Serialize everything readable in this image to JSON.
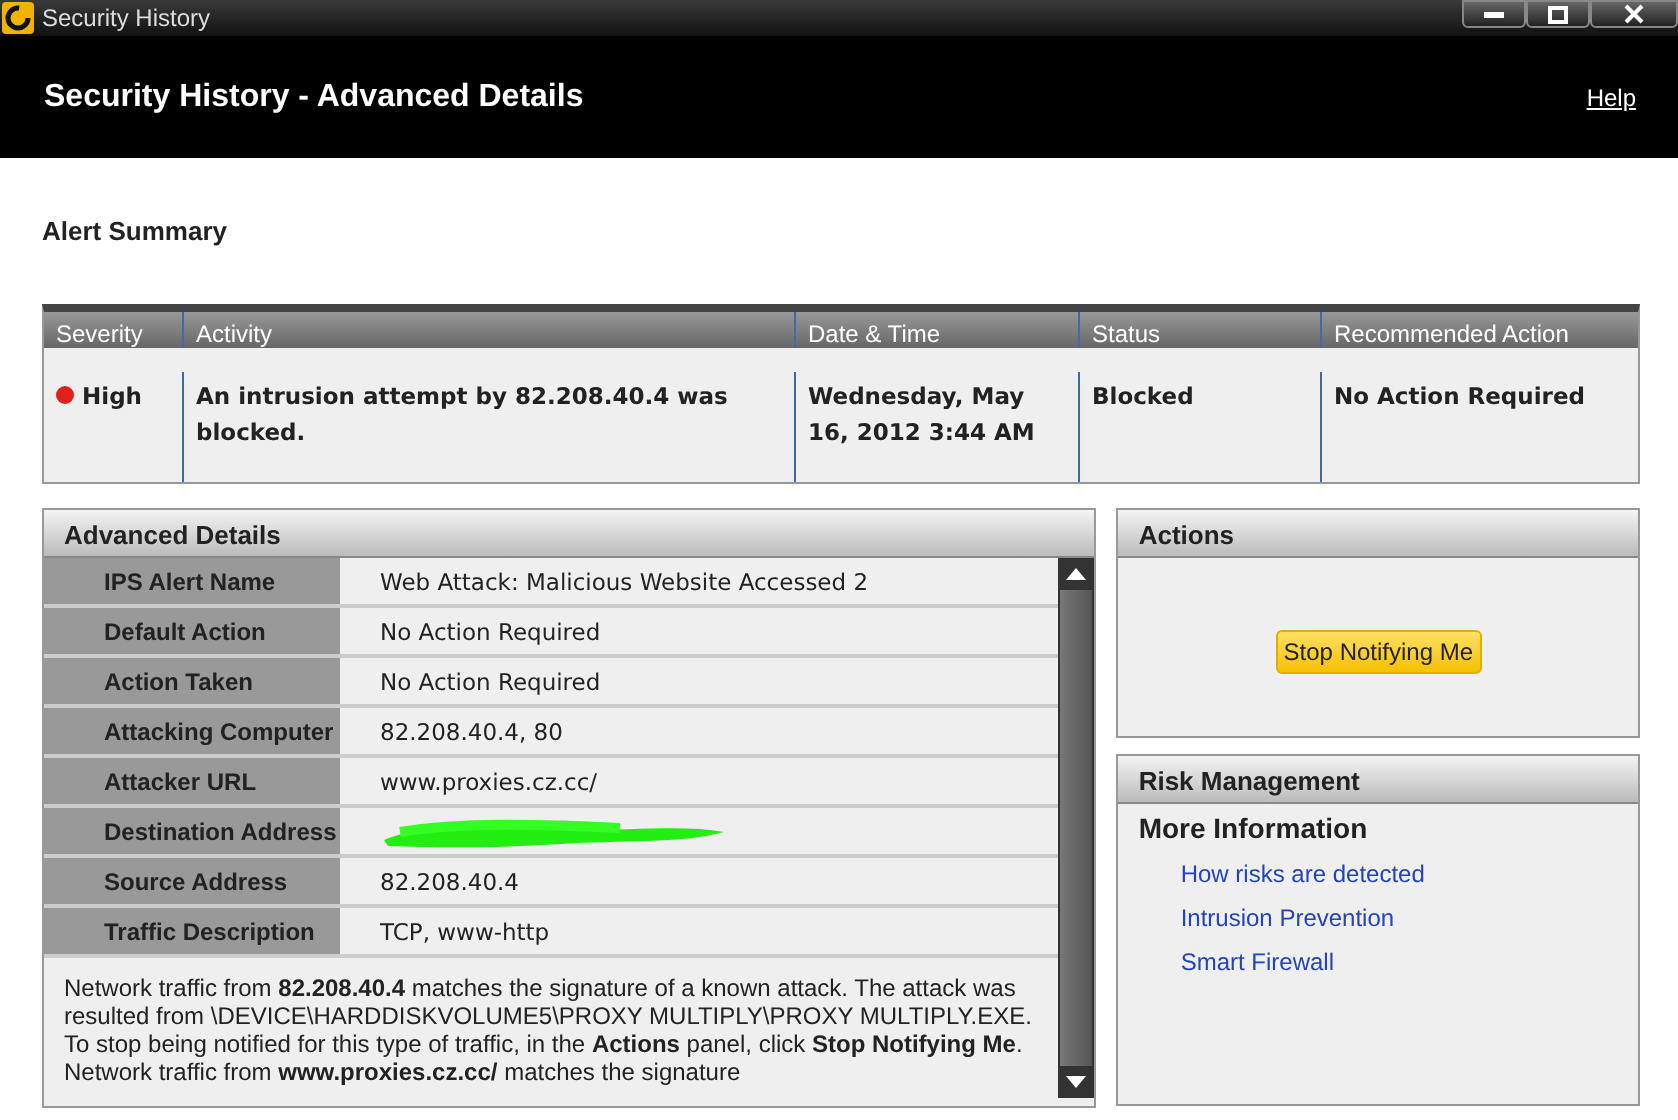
{
  "window": {
    "title": "Security History"
  },
  "header": {
    "title": "Security History - Advanced Details",
    "help_link": "Help"
  },
  "alert_summary": {
    "title": "Alert Summary",
    "columns": [
      "Severity",
      "Activity",
      "Date & Time",
      "Status",
      "Recommended Action"
    ],
    "rows": [
      {
        "severity": "High",
        "color": "#e0211b",
        "activity": "An intrusion attempt by 82.208.40.4 was blocked.",
        "date_time": "Wednesday, May 16, 2012 3:44 AM",
        "status": "Blocked",
        "recommended_action": "No Action Required"
      }
    ]
  },
  "advanced_details": {
    "title": "Advanced Details",
    "rows": [
      {
        "label": "IPS Alert Name",
        "value": "Web Attack: Malicious Website Accessed 2"
      },
      {
        "label": "Default Action",
        "value": "No Action Required"
      },
      {
        "label": "Action Taken",
        "value": "No Action Required"
      },
      {
        "label": "Attacking Computer",
        "value": "82.208.40.4, 80"
      },
      {
        "label": "Attacker URL",
        "value": "www.proxies.cz.cc/"
      },
      {
        "label": "Destination Address",
        "redacted": true
      },
      {
        "label": "Source Address",
        "value": "82.208.40.4"
      },
      {
        "label": "Traffic Description",
        "value": "TCP, www-http"
      }
    ],
    "description": "Network traffic from **82.208.40.4** matches the signature of a known attack. The attack was resulted from \\DEVICE\\HARDDISKVOLUME5\\PROXY MULTIPLY\\PROXY MULTIPLY.EXE. To stop being notified for this type of traffic, in the **Actions** panel, click **Stop Notifying Me**. Network traffic from **www.proxies.cz.cc/** matches the signature"
  },
  "actions": {
    "title": "Actions",
    "button": "Stop Notifying Me"
  },
  "risk_management": {
    "title": "Risk Management",
    "subtitle": "More Information",
    "links": [
      "How risks are detected",
      "Intrusion Prevention",
      "Smart Firewall"
    ]
  }
}
